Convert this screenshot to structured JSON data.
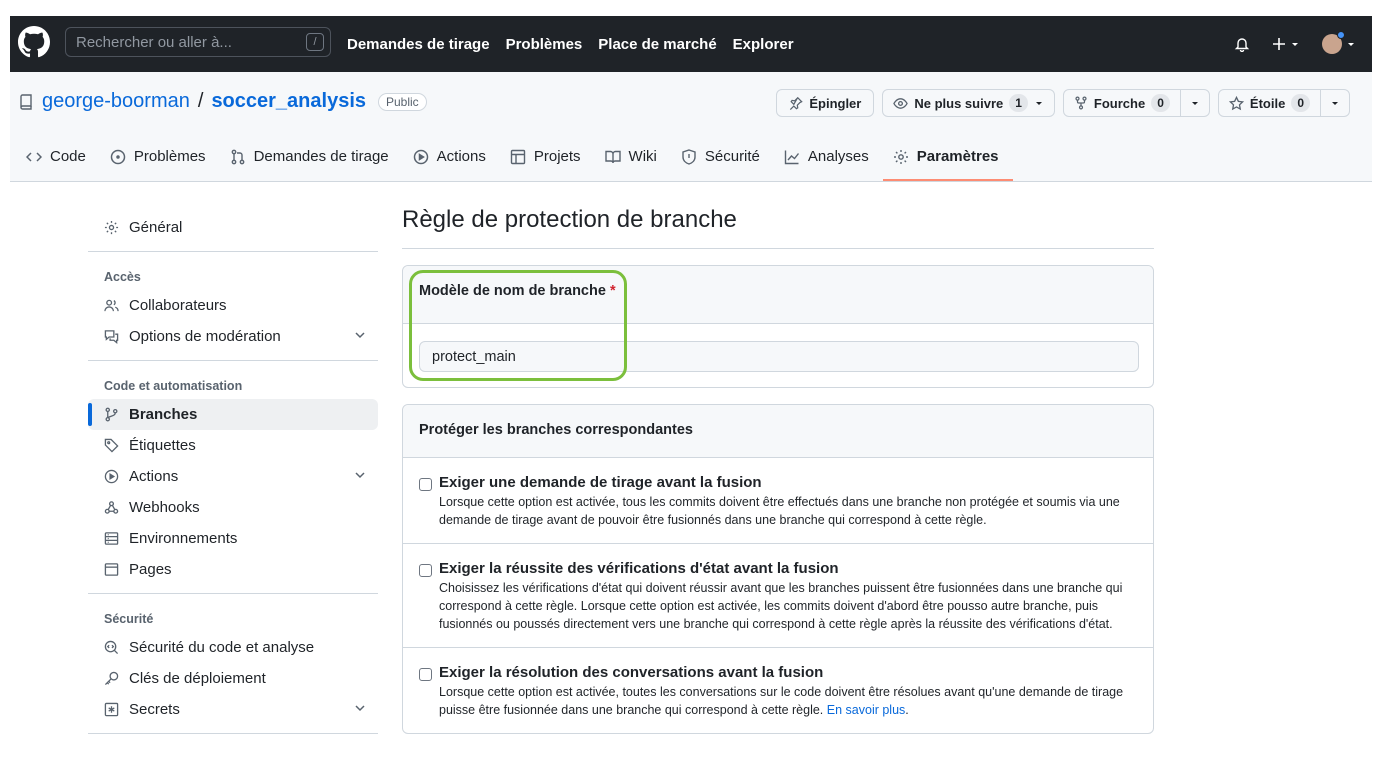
{
  "header": {
    "search_placeholder": "Rechercher ou aller à...",
    "search_shortcut": "/",
    "nav": [
      "Demandes de tirage",
      "Problèmes",
      "Place de marché",
      "Explorer"
    ]
  },
  "repo": {
    "owner": "george-boorman",
    "separator": "/",
    "name": "soccer_analysis",
    "visibility": "Public",
    "pin_label": "Épingler",
    "watch_label": "Ne plus suivre",
    "watch_count": "1",
    "fork_label": "Fourche",
    "fork_count": "0",
    "star_label": "Étoile",
    "star_count": "0"
  },
  "tabs": [
    {
      "label": "Code",
      "icon": "code-icon"
    },
    {
      "label": "Problèmes",
      "icon": "issue-icon"
    },
    {
      "label": "Demandes de tirage",
      "icon": "pull-request-icon"
    },
    {
      "label": "Actions",
      "icon": "play-icon"
    },
    {
      "label": "Projets",
      "icon": "table-icon"
    },
    {
      "label": "Wiki",
      "icon": "book-icon"
    },
    {
      "label": "Sécurité",
      "icon": "shield-icon"
    },
    {
      "label": "Analyses",
      "icon": "graph-icon"
    },
    {
      "label": "Paramètres",
      "icon": "gear-icon",
      "active": true
    }
  ],
  "sidebar": {
    "general": "Général",
    "access_group": "Accès",
    "collaborators": "Collaborateurs",
    "moderation": "Options de modération",
    "code_group": "Code et automatisation",
    "branches": "Branches",
    "tags": "Étiquettes",
    "actions": "Actions",
    "webhooks": "Webhooks",
    "environments": "Environnements",
    "pages": "Pages",
    "security_group": "Sécurité",
    "code_security": "Sécurité du code et analyse",
    "deploy_keys": "Clés de déploiement",
    "secrets": "Secrets"
  },
  "main": {
    "title": "Règle de protection de branche",
    "pattern_label": "Modèle de nom de branche",
    "required_mark": "*",
    "pattern_value": "protect_main",
    "protect_header": "Protéger les branches correspondantes",
    "options": [
      {
        "title": "Exiger une demande de tirage avant la fusion",
        "desc": "Lorsque cette option est activée, tous les commits doivent être effectués dans une branche non protégée et soumis via une demande de tirage avant de pouvoir être fusionnés dans une branche qui correspond à cette règle."
      },
      {
        "title": "Exiger la réussite des vérifications d'état avant la fusion",
        "desc": "Choisissez les vérifications d'état qui doivent réussir avant que les branches puissent être fusionnées dans une branche qui correspond à cette règle. Lorsque cette option est activée, les commits doivent d'abord être pousso autre branche, puis fusionnés ou poussés directement vers une branche qui correspond à cette règle après la réussite des vérifications d'état."
      },
      {
        "title": "Exiger la résolution des conversations avant la fusion",
        "desc": "Lorsque cette option est activée, toutes les conversations sur le code doivent être résolues avant qu'une demande de tirage puisse être fusionnée dans une branche qui correspond à cette règle.",
        "link": "En savoir plus",
        "after_link": "."
      }
    ]
  },
  "colors": {
    "header_bg": "#1f2328",
    "link": "#0969da",
    "active_tab_underline": "#fd8c73",
    "highlight": "#7bbf3c"
  }
}
